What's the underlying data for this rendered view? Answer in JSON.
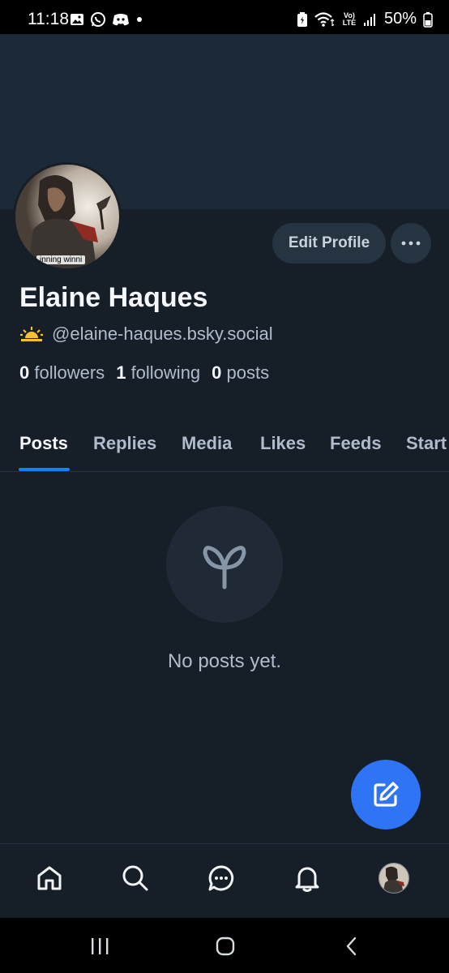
{
  "status_bar": {
    "time": "11:18",
    "battery": "50%",
    "network": "Vo) LTE",
    "left_icons": [
      "image-icon",
      "whatsapp-icon",
      "discord-icon",
      "dot-icon"
    ],
    "right_icons": [
      "battery-saver-icon",
      "wifi-icon",
      "volte-icon",
      "signal-icon",
      "battery-icon"
    ]
  },
  "profile": {
    "avatar_caption": "inning winni",
    "display_name": "Elaine Haques",
    "handle": "@elaine-haques.bsky.social",
    "handle_emoji": "sunrise-icon",
    "stats": {
      "followers_count": "0",
      "followers_label": "followers",
      "following_count": "1",
      "following_label": "following",
      "posts_count": "0",
      "posts_label": "posts"
    },
    "edit_button": "Edit Profile"
  },
  "tabs": [
    {
      "label": "Posts",
      "active": true
    },
    {
      "label": "Replies"
    },
    {
      "label": "Media"
    },
    {
      "label": "Likes"
    },
    {
      "label": "Feeds"
    },
    {
      "label": "Start"
    }
  ],
  "empty_state": {
    "icon": "sprout-icon",
    "text": "No posts yet."
  },
  "fab": {
    "icon": "compose-icon"
  },
  "bottom_nav": [
    "home-icon",
    "search-icon",
    "chat-icon",
    "bell-icon",
    "profile-avatar"
  ],
  "colors": {
    "background": "#161e27",
    "banner": "#1c2a38",
    "accent": "#1083fe",
    "fab": "#2f74f5",
    "button": "#263341"
  }
}
